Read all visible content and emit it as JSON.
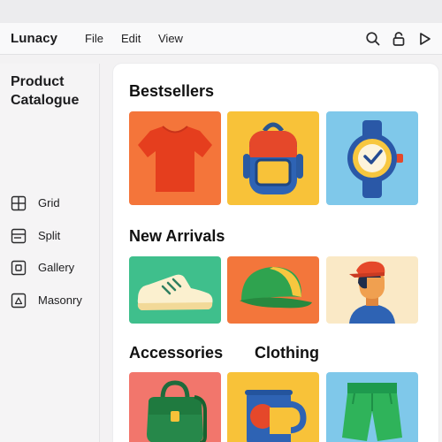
{
  "app": {
    "name": "Lunacy"
  },
  "menu": {
    "file": "File",
    "edit": "Edit",
    "view": "View"
  },
  "toolbar": {
    "icons": [
      "search-icon",
      "lock-icon",
      "play-icon"
    ]
  },
  "sidebar": {
    "title_line1": "Product",
    "title_line2": "Catalogue",
    "views": [
      {
        "label": "Grid",
        "icon": "grid-view-icon"
      },
      {
        "label": "Split",
        "icon": "split-view-icon"
      },
      {
        "label": "Gallery",
        "icon": "gallery-view-icon"
      },
      {
        "label": "Masonry",
        "icon": "masonry-view-icon"
      }
    ]
  },
  "sections": {
    "bestsellers": {
      "title": "Bestsellers",
      "items": [
        {
          "icon": "tshirt-icon",
          "bg": "#f4753a"
        },
        {
          "icon": "backpack-icon",
          "bg": "#f8c239"
        },
        {
          "icon": "wristwatch-icon",
          "bg": "#7fc8ea"
        }
      ]
    },
    "new_arrivals": {
      "title": "New Arrivals",
      "items": [
        {
          "icon": "sneaker-icon",
          "bg": "#3fbf8c"
        },
        {
          "icon": "cap-icon",
          "bg": "#f3763b"
        },
        {
          "icon": "person-avatar-icon",
          "bg": "#fae9c6"
        }
      ]
    },
    "accessories": {
      "title": "Accessories",
      "items": [
        {
          "icon": "handbag-icon",
          "bg": "#f2766c"
        },
        {
          "icon": "mug-icon",
          "bg": "#f8c239"
        }
      ]
    },
    "clothing": {
      "title": "Clothing",
      "items": [
        {
          "icon": "shorts-icon",
          "bg": "#7fc8ea"
        }
      ]
    }
  },
  "colors": {
    "background": "#f3f2f3",
    "content_bg": "#ffffff",
    "text": "#1c1c1e"
  }
}
